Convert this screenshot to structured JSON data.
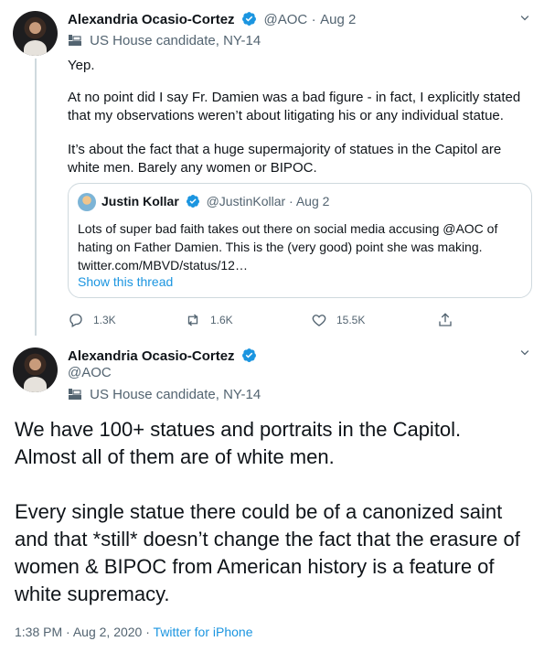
{
  "colors": {
    "accent": "#1b95e0",
    "muted": "#536471",
    "border": "#cfd9de"
  },
  "tweet1": {
    "author_name": "Alexandria Ocasio-Cortez",
    "handle": "@AOC",
    "separator": "·",
    "date": "Aug 2",
    "label": "US House candidate, NY-14",
    "text_line1": "Yep.",
    "text_p2": "At no point did I say Fr. Damien was a bad figure - in fact, I explicitly stated that my observations weren’t about litigating his or any individual statue.",
    "text_p3": "It’s about the fact that a huge supermajority of statues in the Capitol are white men. Barely any women or BIPOC.",
    "quote": {
      "author_name": "Justin Kollar",
      "handle": "@JustinKollar",
      "separator": "·",
      "date": "Aug 2",
      "text": "Lots of super bad faith takes out there on social media accusing @AOC of hating on Father Damien. This is the (very good) point she was making. twitter.com/MBVD/status/12…",
      "show_thread": "Show this thread"
    },
    "actions": {
      "replies": "1.3K",
      "retweets": "1.6K",
      "likes": "15.5K"
    }
  },
  "tweet2": {
    "author_name": "Alexandria Ocasio-Cortez",
    "handle": "@AOC",
    "label": "US House candidate, NY-14",
    "text_p1": "We have 100+ statues and portraits in the Capitol. Almost all of them are of white men.",
    "text_p2": "Every single statue there could be of a canonized saint and that *still* doesn’t change the fact that the erasure of women & BIPOC from American history is a feature of white supremacy.",
    "time": "1:38 PM",
    "separator": "·",
    "date": "Aug 2, 2020",
    "separator2": "·",
    "source": "Twitter for iPhone"
  },
  "icons": [
    "verified-badge-icon",
    "chevron-down-icon",
    "government-label-icon",
    "reply-icon",
    "retweet-icon",
    "like-icon",
    "share-icon"
  ]
}
